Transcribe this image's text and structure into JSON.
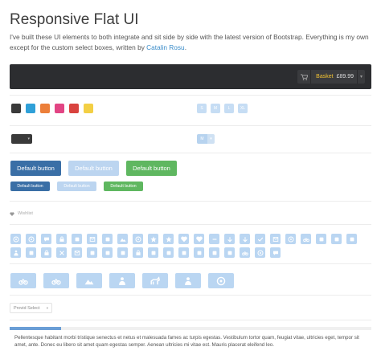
{
  "header": {
    "title": "Responsive Flat UI",
    "intro_before": "I've built these UI elements to both integrate and sit side by side with the latest version of Bootstrap. Everything is my own except for the custom select boxes, written by ",
    "intro_link": "Catalin Rosu",
    "intro_after": "."
  },
  "topbar": {
    "basket_label": "Basket",
    "basket_price": "£89.99",
    "basket_caret": "▾"
  },
  "colors": {
    "swatches": [
      "#3a3a3a",
      "#2fa0d8",
      "#ec7f3a",
      "#e24584",
      "#d9433f",
      "#f3cf44"
    ],
    "accent": "#3a8cc9",
    "button_blue": "#3a6fa6",
    "button_light": "#bcd5f0",
    "button_green": "#5fb760"
  },
  "sizes": {
    "labels": [
      "S",
      "M",
      "L",
      "XL"
    ]
  },
  "mini_dropdown": {
    "label": "M",
    "caret": "▾"
  },
  "dark_select": {
    "caret": "▾"
  },
  "buttons": {
    "large": [
      "Default button",
      "Default button",
      "Default button"
    ],
    "small": [
      "Default button",
      "Default button",
      "Default button"
    ]
  },
  "wishlist": {
    "label": "Wishlist"
  },
  "icons": {
    "small": [
      "globe-icon",
      "clock-icon",
      "chat-icon",
      "briefcase-icon",
      "settings-icon",
      "file-icon",
      "calendar-icon",
      "image-icon",
      "target-icon",
      "star-icon",
      "star-outline-icon",
      "heart-icon",
      "heart-outline-icon",
      "minus-icon",
      "down-arrow-icon",
      "arrow-icon",
      "check-icon",
      "mail-icon",
      "refresh-icon",
      "car-icon",
      "plane-icon",
      "rocket-icon",
      "pin-icon",
      "user-icon",
      "tag-icon",
      "lock-icon",
      "close-icon",
      "book-icon",
      "home-icon",
      "phone-icon",
      "camera-icon",
      "print-icon",
      "play-icon",
      "skip-icon",
      "search-icon",
      "music-icon",
      "list-icon",
      "grid-icon",
      "cart-icon",
      "info-icon",
      "bell-icon"
    ],
    "big": [
      "bicycle-icon",
      "motorbike-icon",
      "mountain-icon",
      "runner-icon",
      "horse-icon",
      "wheelchair-icon",
      "lifebuoy-icon"
    ]
  },
  "select": {
    "value": "Provid Select",
    "caret": "▾"
  },
  "tab": {
    "text": "Pellentesque habitant morbi tristique senectus et netus et malesuada fames ac turpis egestas. Vestibulum tortor quam, feugiat vitae, ultricies eget, tempor sit amet, ante. Donec eu libero sit amet quam egestas semper. Aenean ultricies mi vitae est. Mauris placerat eleifend leo."
  }
}
